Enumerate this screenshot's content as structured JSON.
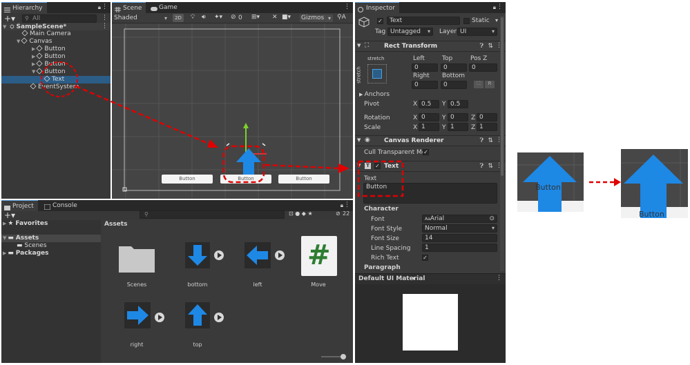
{
  "hierarchy": {
    "tab": "Hierarchy",
    "search_placeholder": "All",
    "scene": "SampleScene*",
    "items": [
      "Main Camera",
      "Canvas",
      "Button",
      "Button",
      "Button",
      "Button",
      "Text",
      "EventSystem"
    ]
  },
  "scene_view": {
    "tabs": [
      "Scene",
      "Game"
    ],
    "shading": "Shaded",
    "mode_2d": "2D",
    "gizmos": "Gizmos",
    "hidden_count": "0",
    "buttons": [
      "Button",
      "Button",
      "Button"
    ]
  },
  "project": {
    "tabs": [
      "Project",
      "Console"
    ],
    "tree": [
      "Favorites",
      "Assets",
      "Scenes",
      "Packages"
    ],
    "breadcrumb": "Assets",
    "count": "22",
    "assets": [
      "Scenes",
      "bottom",
      "left",
      "Move",
      "right",
      "top"
    ]
  },
  "inspector": {
    "tab": "Inspector",
    "object_name": "Text",
    "static_label": "Static",
    "tag_label": "Tag",
    "tag_value": "Untagged",
    "layer_label": "Layer",
    "layer_value": "UI",
    "rect_transform": {
      "title": "Rect Transform",
      "stretch": "stretch",
      "left_label": "Left",
      "top_label": "Top",
      "posz_label": "Pos Z",
      "left": "0",
      "top": "0",
      "posz": "0",
      "right_label": "Right",
      "bottom_label": "Bottom",
      "right": "0",
      "bottom": "0",
      "r_button": "R",
      "anchors": "Anchors",
      "pivot_label": "Pivot",
      "pivot_x": "0.5",
      "pivot_y": "0.5",
      "rotation_label": "Rotation",
      "rot_x": "0",
      "rot_y": "0",
      "rot_z": "0",
      "scale_label": "Scale",
      "scale_x": "1",
      "scale_y": "1",
      "scale_z": "1",
      "x": "X",
      "y": "Y",
      "z": "Z"
    },
    "canvas_renderer": {
      "title": "Canvas Renderer",
      "cull_label": "Cull Transparent Mes"
    },
    "text_component": {
      "title": "Text",
      "text_label": "Text",
      "text_value": "Button",
      "character": "Character",
      "font_label": "Font",
      "font_value": "Arial",
      "font_style_label": "Font Style",
      "font_style_value": "Normal",
      "font_size_label": "Font Size",
      "font_size_value": "14",
      "line_spacing_label": "Line Spacing",
      "line_spacing_value": "1",
      "rich_text_label": "Rich Text",
      "paragraph": "Paragraph"
    },
    "material": "Default UI Material"
  },
  "zoom_panels": {
    "before_label": "Button",
    "after_label": "Button"
  },
  "colors": {
    "highlight_red": "#e00000",
    "selection_blue": "#2c5d87",
    "arrow_blue": "#1e88e5"
  }
}
